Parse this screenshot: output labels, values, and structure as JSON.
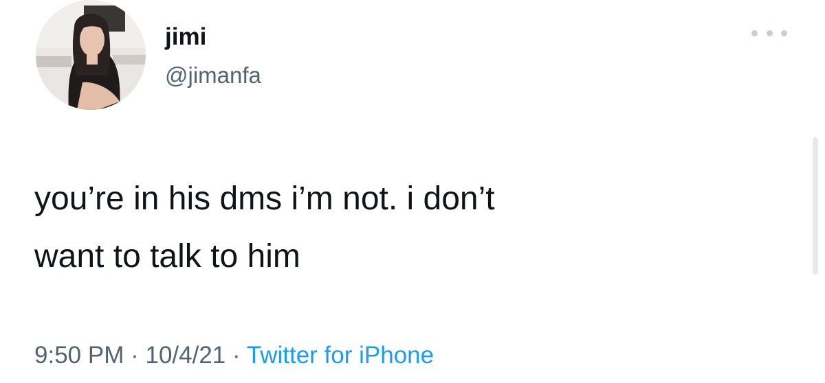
{
  "tweet": {
    "author": {
      "display_name": "jimi",
      "handle": "@jimanfa",
      "avatar_icon": "profile-photo-avatar"
    },
    "more_icon": "ellipsis-icon",
    "text_line_1": "you’re in his dms i’m not. i don’t",
    "text_line_2": "want to talk to him",
    "time": "9:50 PM",
    "separator": "·",
    "date": "10/4/21",
    "source": "Twitter for iPhone"
  },
  "colors": {
    "text": "#0f1419",
    "secondary": "#536471",
    "link": "#1d9bf0"
  }
}
